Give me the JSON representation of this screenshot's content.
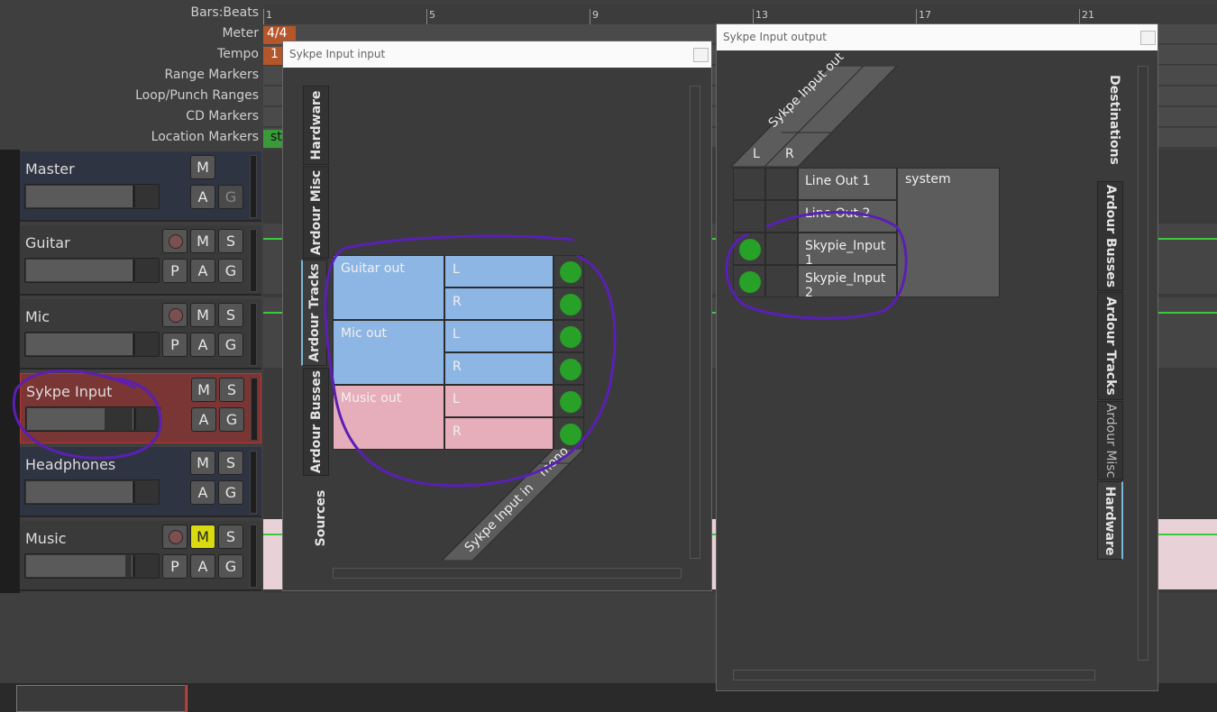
{
  "ruler": {
    "labels": [
      "Bars:Beats",
      "Meter",
      "Tempo",
      "Range Markers",
      "Loop/Punch Ranges",
      "CD Markers",
      "Location Markers"
    ],
    "bars": [
      "1",
      "5",
      "9",
      "13",
      "17",
      "21"
    ],
    "meter_value": "4/4",
    "tempo_value": "1",
    "location_marker": "st"
  },
  "tracks": [
    {
      "name": "Master"
    },
    {
      "name": "Guitar",
      "g": "G",
      "p": "P"
    },
    {
      "name": "Mic",
      "g": "G",
      "p": "P"
    },
    {
      "name": "Sykpe Input"
    },
    {
      "name": "Headphones"
    },
    {
      "name": "Music",
      "p": "P"
    }
  ],
  "buttons": {
    "m": "M",
    "s": "S",
    "a": "A",
    "g": "G",
    "p": "P"
  },
  "input_window": {
    "title": "Sykpe Input input",
    "tabs": [
      "Hardware",
      "Ardour Misc",
      "Ardour Tracks",
      "Ardour Busses"
    ],
    "sources_label": "Sources",
    "rows": [
      {
        "group": "Guitar out",
        "channels": [
          "L",
          "R"
        ],
        "color": "#8eb6e4"
      },
      {
        "group": "Mic out",
        "channels": [
          "L",
          "R"
        ],
        "color": "#8eb6e4"
      },
      {
        "group": "Music out",
        "channels": [
          "L",
          "R"
        ],
        "color": "#e6aebb"
      }
    ],
    "diag_port": "Sykpe Input in",
    "diag_ch": "mono",
    "connections": [
      true,
      true,
      true,
      true,
      true,
      true
    ]
  },
  "output_window": {
    "title": "Sykpe Input output",
    "diag_port": "Sykpe Input out",
    "cols": [
      "L",
      "R"
    ],
    "group": "system",
    "ports": [
      "Line Out 1",
      "Line Out 2",
      "Skypie_Input 1",
      "Skypie_Input 2"
    ],
    "connections": [
      [
        false,
        false
      ],
      [
        false,
        false
      ],
      [
        true,
        false
      ],
      [
        true,
        false
      ]
    ],
    "destinations_label": "Destinations",
    "tabs": [
      "Ardour Busses",
      "Ardour Tracks",
      "Ardour Misc",
      "Hardware"
    ]
  },
  "accent": "#5a1fb4"
}
